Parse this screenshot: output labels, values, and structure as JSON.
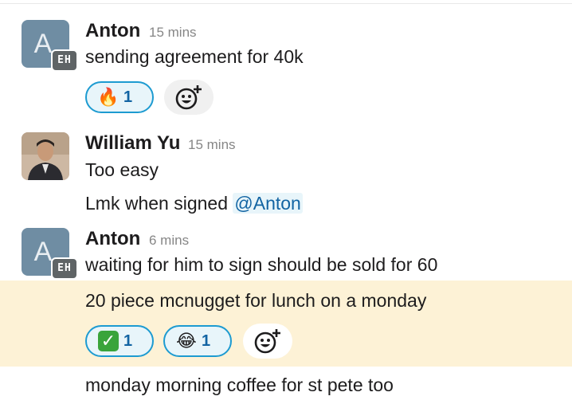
{
  "messages": [
    {
      "author": "Anton",
      "time": "15 mins",
      "avatar_letter": "A",
      "badge": "EH",
      "text": "sending agreement for 40k"
    },
    {
      "author": "William Yu",
      "time": "15 mins",
      "text": "Too easy",
      "text2_prefix": "Lmk when signed ",
      "mention": "@Anton"
    },
    {
      "author": "Anton",
      "time": "6 mins",
      "avatar_letter": "A",
      "badge": "EH",
      "text": "waiting for him to sign should be sold for 60",
      "text2": "20 piece mcnugget for lunch on a monday",
      "text3": "monday morning coffee for st pete too"
    }
  ],
  "reactions_1": [
    {
      "emoji": "fire",
      "glyph": "🔥",
      "count": "1"
    }
  ],
  "reactions_2": [
    {
      "emoji": "white-check-mark",
      "glyph": "✓",
      "count": "1"
    },
    {
      "emoji": "joy",
      "glyph": "😂",
      "count": "1"
    }
  ],
  "icons": {
    "add_reaction": "add-reaction-icon"
  },
  "colors": {
    "highlight": "#fdf2d6",
    "reaction_border": "#1d9bd1",
    "mention": "#1264a3"
  }
}
